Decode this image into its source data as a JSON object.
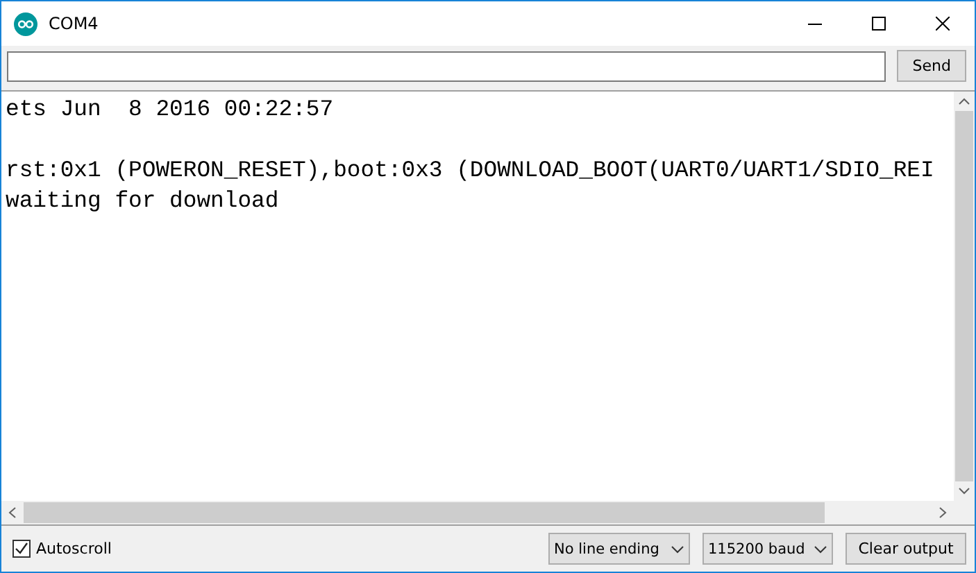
{
  "window": {
    "title": "COM4"
  },
  "send_button": "Send",
  "output": {
    "paragraphs": [
      [
        "ets Jun  8 2016 00:22:57"
      ],
      [
        "rst:0x1 (POWERON_RESET),boot:0x3 (DOWNLOAD_BOOT(UART0/UART1/SDIO_REI",
        "waiting for download"
      ]
    ]
  },
  "autoscroll": {
    "label": "Autoscroll",
    "checked": true
  },
  "line_ending": "No line ending",
  "baud": "115200 baud",
  "clear_button": "Clear output"
}
